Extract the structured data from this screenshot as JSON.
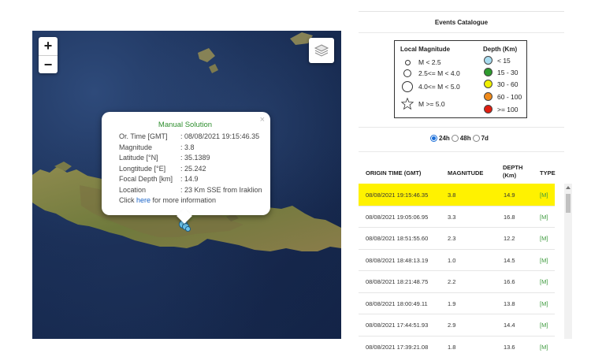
{
  "map": {
    "zoom_in": "+",
    "zoom_out": "−",
    "layers_icon": "layers-icon",
    "popup": {
      "title": "Manual Solution",
      "close": "×",
      "rows": [
        {
          "label": "Or. Time [GMT]",
          "value": ": 08/08/2021 19:15:46.35"
        },
        {
          "label": "Magnitude",
          "value": ": 3.8"
        },
        {
          "label": "Latitude [°N]",
          "value": ": 35.1389"
        },
        {
          "label": "Longtitude [°E]",
          "value": ": 25.242"
        },
        {
          "label": "Focal Depth [km]",
          "value": ": 14.9"
        },
        {
          "label": "Location",
          "value": ": 23 Km SSE from Iraklion"
        }
      ],
      "more_prefix": "Click ",
      "more_link": "here",
      "more_suffix": " for more information"
    }
  },
  "catalogue": {
    "title": "Events Catalogue",
    "legend": {
      "magnitude_title": "Local Magnitude",
      "depth_title": "Depth (Km)",
      "magnitudes": [
        "M < 2.5",
        "2.5<= M < 4.0",
        "4.0<= M < 5.0",
        "M >= 5.0"
      ],
      "depths": [
        {
          "label": "< 15",
          "color": "#a8dcf0"
        },
        {
          "label": "15 - 30",
          "color": "#2e9b2e"
        },
        {
          "label": "30 - 60",
          "color": "#f0f000"
        },
        {
          "label": "60 - 100",
          "color": "#f08a1a"
        },
        {
          "label": ">= 100",
          "color": "#e01e10"
        }
      ]
    },
    "ranges": [
      {
        "label": "24h",
        "selected": true
      },
      {
        "label": "48h",
        "selected": false
      },
      {
        "label": "7d",
        "selected": false
      }
    ],
    "columns": {
      "origin_time": "ORIGIN TIME (GMT)",
      "magnitude": "MAGNITUDE",
      "depth_line1": "DEPTH",
      "depth_line2": "(Km)",
      "type": "TYPE"
    },
    "rows": [
      {
        "time": "08/08/2021 19:15:46.35",
        "mag": "3.8",
        "depth": "14.9",
        "type": "[M]"
      },
      {
        "time": "08/08/2021 19:05:06.95",
        "mag": "3.3",
        "depth": "16.8",
        "type": "[M]"
      },
      {
        "time": "08/08/2021 18:51:55.60",
        "mag": "2.3",
        "depth": "12.2",
        "type": "[M]"
      },
      {
        "time": "08/08/2021 18:48:13.19",
        "mag": "1.0",
        "depth": "14.5",
        "type": "[M]"
      },
      {
        "time": "08/08/2021 18:21:48.75",
        "mag": "2.2",
        "depth": "16.6",
        "type": "[M]"
      },
      {
        "time": "08/08/2021 18:00:49.11",
        "mag": "1.9",
        "depth": "13.8",
        "type": "[M]"
      },
      {
        "time": "08/08/2021 17:44:51.93",
        "mag": "2.9",
        "depth": "14.4",
        "type": "[M]"
      },
      {
        "time": "08/08/2021 17:39:21.08",
        "mag": "1.8",
        "depth": "13.6",
        "type": "[M]"
      }
    ]
  }
}
